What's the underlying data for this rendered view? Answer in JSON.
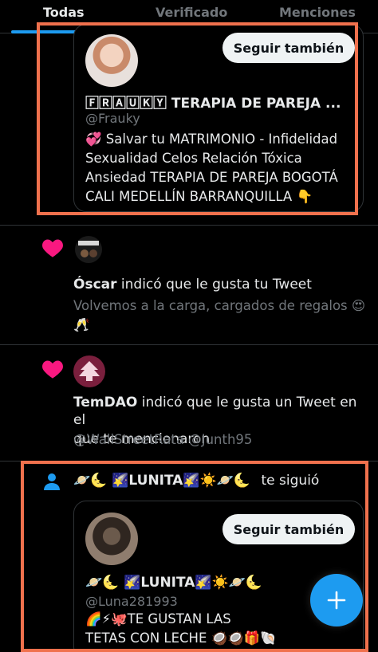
{
  "tabs": [
    {
      "label": "Todas"
    },
    {
      "label": "Verificado"
    },
    {
      "label": "Menciones"
    }
  ],
  "colors": {
    "accent": "#1d9bf0",
    "like": "#f91880",
    "highlight": "#f0714d"
  },
  "card1": {
    "name": "🄵🅁🄰🅄🄺🅈 TERAPIA DE PAREJA ...",
    "handle": "@Frauky",
    "follow_label": "Seguir también",
    "bio_lines": [
      "💞 Salvar tu MATRIMONIO - Infidelidad",
      "Sexualidad Celos Relación Tóxica",
      "Ansiedad TERAPIA DE PAREJA BOGOTÁ",
      "CALI MEDELLÍN BARRANQUILLA 👇"
    ]
  },
  "notif_like_1": {
    "user": "Óscar",
    "action": " indicó que le gusta tu Tweet",
    "tweet_line1": "Volvemos a la carga, cargados de regalos 😍",
    "tweet_line2": "🥂",
    "icon": "heart-icon"
  },
  "notif_like_2": {
    "user": "TemDAO",
    "action": " indicó que le gusta un Tweet en el",
    "action_line2": "que te mencionaron",
    "mentions": "@WallStreetRata @Junth95",
    "icon": "heart-icon"
  },
  "notif_follow": {
    "user_emoji_name": "🪐🌜 🌠LUNITA🌠☀️🪐🌜",
    "action": "te siguió",
    "icon": "person-icon"
  },
  "card2": {
    "name": "🪐🌜 🌠LUNITA🌠☀️🪐🌜",
    "handle": "@Luna281993",
    "follow_label": "Seguir también",
    "bio_lines": [
      "🌈⚡🐙TE GUSTAN LAS",
      "TETAS CON LECHE 🥥🥥🎁🐚"
    ]
  },
  "fab": {
    "label": "+",
    "icon": "compose-plus-icon"
  }
}
